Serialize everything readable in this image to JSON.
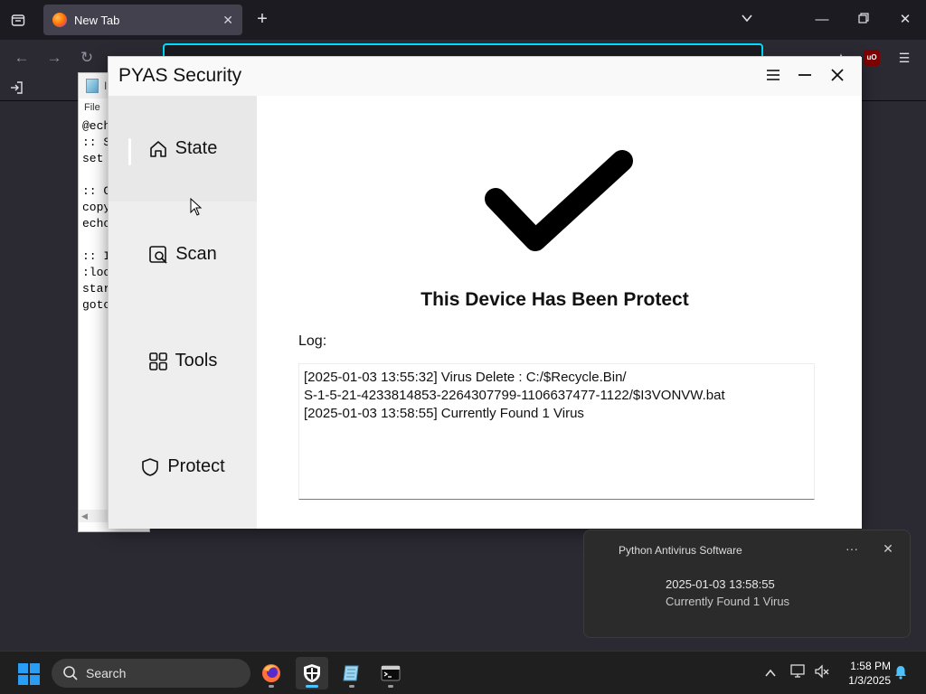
{
  "browser": {
    "tab_title": "New Tab",
    "tab_close_icon": "close-icon",
    "new_tab_icon": "plus-icon",
    "list_all_tabs_icon": "chevron-down-icon",
    "ublock_label": "uO"
  },
  "notepad": {
    "title": "Ir",
    "menu_file": "File",
    "lines": [
      "@ech",
      ":: S",
      "set ",
      "",
      ":: C",
      "copy",
      "echo",
      "",
      ":: I",
      ":loo",
      "star",
      "goto"
    ]
  },
  "pyas": {
    "title": "PYAS Security",
    "sidebar": {
      "items": [
        {
          "label": "State",
          "icon": "home-icon"
        },
        {
          "label": "Scan",
          "icon": "scan-icon"
        },
        {
          "label": "Tools",
          "icon": "tools-icon"
        },
        {
          "label": "Protect",
          "icon": "shield-icon"
        }
      ],
      "active": "State"
    },
    "main": {
      "status_title": "This Device Has Been Protect",
      "log_label": "Log:",
      "log_lines": [
        "[2025-01-03 13:55:32] Virus Delete : C:/$Recycle.Bin/",
        "S-1-5-21-4233814853-2264307799-1106637477-1122/$I3VONVW.bat",
        "[2025-01-03 13:58:55] Currently Found 1 Virus"
      ]
    }
  },
  "toast": {
    "app_name": "Python Antivirus Software",
    "line1": "2025-01-03 13:58:55",
    "line2": "Currently Found 1 Virus"
  },
  "taskbar": {
    "search_label": "Search",
    "time": "1:58 PM",
    "date": "1/3/2025",
    "accent_color": "#2a9df4"
  }
}
